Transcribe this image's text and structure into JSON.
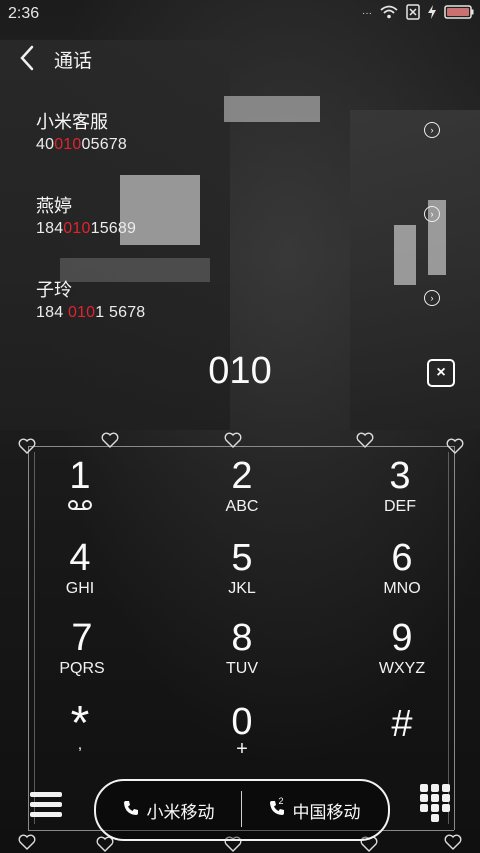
{
  "status_bar": {
    "time": "2:36"
  },
  "header": {
    "title": "通话"
  },
  "suggestions": [
    {
      "name": "小米客服",
      "num_pre": "40",
      "num_hl": "010",
      "num_post": "05678"
    },
    {
      "name": "燕婷",
      "num_pre": "184",
      "num_hl": "010",
      "num_post": "15689"
    },
    {
      "name": "子玲",
      "num_pre": "184 ",
      "num_hl": "010",
      "num_post": "1 5678"
    }
  ],
  "dial": {
    "digits": "010",
    "clear_label": "×"
  },
  "keypad": [
    {
      "digit": "1",
      "letters": ""
    },
    {
      "digit": "2",
      "letters": "ABC"
    },
    {
      "digit": "3",
      "letters": "DEF"
    },
    {
      "digit": "4",
      "letters": "GHI"
    },
    {
      "digit": "5",
      "letters": "JKL"
    },
    {
      "digit": "6",
      "letters": "MNO"
    },
    {
      "digit": "7",
      "letters": "PQRS"
    },
    {
      "digit": "8",
      "letters": "TUV"
    },
    {
      "digit": "9",
      "letters": "WXYZ"
    },
    {
      "digit": "*",
      "letters": ","
    },
    {
      "digit": "0",
      "letters": "+"
    },
    {
      "digit": "#",
      "letters": ""
    }
  ],
  "bottom": {
    "sim1_label": "小米移动",
    "sim2_label": "中国移动",
    "sim2_index": "2"
  },
  "icons": {
    "voicemail": "voicemail-icon",
    "menu": "menu-icon",
    "keypad_toggle": "keypad-toggle-icon",
    "call": "phone-icon"
  },
  "colors": {
    "highlight": "#e0242f"
  }
}
